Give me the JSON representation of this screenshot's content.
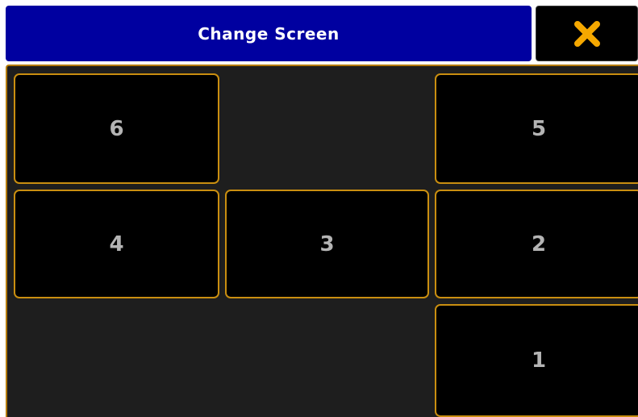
{
  "dialog": {
    "title": "Change Screen",
    "close_icon": "close-x-icon",
    "accent_color": "#c98e10",
    "title_bar_color": "#0000a0",
    "close_icon_color": "#f5a800"
  },
  "screens": [
    {
      "label": "6"
    },
    {
      "label": "5"
    },
    {
      "label": "4"
    },
    {
      "label": "3"
    },
    {
      "label": "2"
    },
    {
      "label": "1"
    }
  ]
}
